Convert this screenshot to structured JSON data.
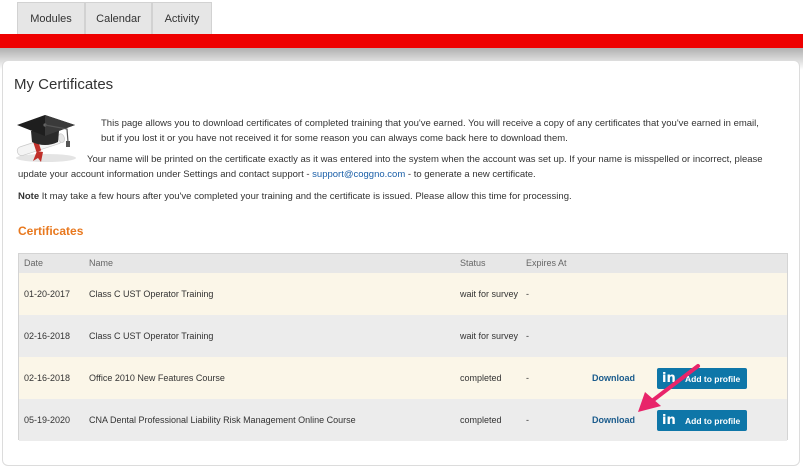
{
  "tabs": [
    {
      "label": "Modules"
    },
    {
      "label": "Calendar"
    },
    {
      "label": "Activity"
    }
  ],
  "page": {
    "title": "My Certificates",
    "intro1": "This page allows you to download certificates of completed training that you've earned. You will receive a copy of any certificates that you've earned in email, but if you lost it or you have not received it for some reason you can always come back here to download them.",
    "intro2_before": "Your name will be printed on the certificate exactly as it was entered into the system when the account was set up. If your name is misspelled or incorrect, please update your account information under Settings and contact support - ",
    "support_email": "support@coggno.com",
    "intro2_after": " - to generate a new certificate.",
    "note_label": "Note",
    "note_text": " It may take a few hours after you've completed your training and the certificate is issued. Please allow this time for processing."
  },
  "certificates": {
    "section_title": "Certificates",
    "columns": {
      "date": "Date",
      "name": "Name",
      "status": "Status",
      "expires": "Expires At"
    },
    "rows": [
      {
        "date": "01-20-2017",
        "name": "Class C UST Operator Training",
        "status": "wait for survey",
        "expires": "-"
      },
      {
        "date": "02-16-2018",
        "name": "Class C UST Operator Training",
        "status": "wait for survey",
        "expires": "-"
      },
      {
        "date": "02-16-2018",
        "name": "Office 2010 New Features Course",
        "status": "completed",
        "expires": "-",
        "download": "Download",
        "linkedin_logo": "in",
        "linkedin": "Add to profile"
      },
      {
        "date": "05-19-2020",
        "name": "CNA Dental Professional Liability Risk Management Online Course",
        "status": "completed",
        "expires": "-",
        "download": "Download",
        "linkedin_logo": "in",
        "linkedin": "Add to profile"
      }
    ]
  },
  "colors": {
    "brand_red": "#ee0000",
    "section_orange": "#e8781e",
    "linkedin_blue": "#0e76a8",
    "annotation_pink": "#e8246a"
  },
  "icons": {
    "graduation": "graduation-cap-icon",
    "arrow": "annotation-arrow-icon"
  }
}
